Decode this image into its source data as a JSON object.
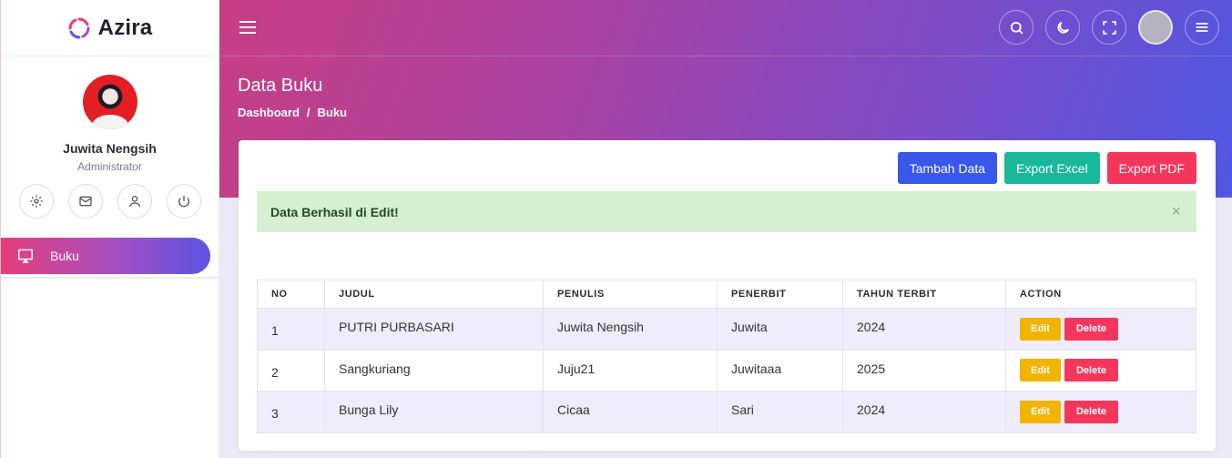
{
  "app": {
    "name": "Azira"
  },
  "user": {
    "name": "Juwita Nengsih",
    "role": "Administrator"
  },
  "sidebar": {
    "items": [
      {
        "label": "Buku",
        "icon": "monitor-icon"
      }
    ]
  },
  "page": {
    "title": "Data Buku",
    "breadcrumb": [
      "Dashboard",
      "/",
      "Buku"
    ]
  },
  "toolbar": {
    "add_label": "Tambah Data",
    "excel_label": "Export Excel",
    "pdf_label": "Export PDF"
  },
  "alert": {
    "message": "Data Berhasil di Edit!",
    "close": "×"
  },
  "table": {
    "headers": [
      "NO",
      "JUDUL",
      "PENULIS",
      "PENERBIT",
      "TAHUN TERBIT",
      "ACTION"
    ],
    "rows": [
      {
        "no": "1",
        "judul": "PUTRI PURBASARI",
        "penulis": "Juwita Nengsih",
        "penerbit": "Juwita",
        "tahun": "2024"
      },
      {
        "no": "2",
        "judul": "Sangkuriang",
        "penulis": "Juju21",
        "penerbit": "Juwitaaa",
        "tahun": "2025"
      },
      {
        "no": "3",
        "judul": "Bunga Lily",
        "penulis": "Cicaa",
        "penerbit": "Sari",
        "tahun": "2024"
      }
    ],
    "edit_label": "Edit",
    "delete_label": "Delete"
  },
  "colors": {
    "primary": "#3858e9",
    "success": "#1ab89a",
    "danger": "#f5365c",
    "warning": "#f1b400"
  }
}
